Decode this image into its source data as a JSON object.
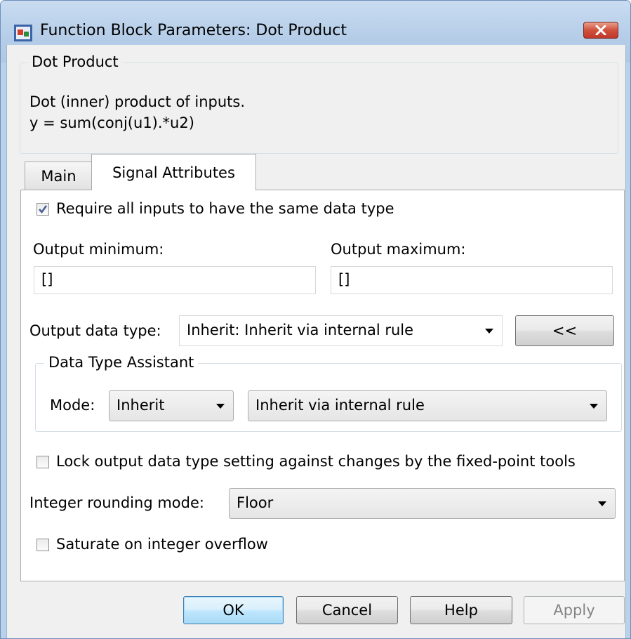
{
  "window": {
    "title": "Function Block Parameters: Dot Product"
  },
  "description": {
    "group_title": "Dot Product",
    "line1": "Dot (inner) product of inputs.",
    "line2": "y = sum(conj(u1).*u2)"
  },
  "tabs": [
    {
      "label": "Main",
      "selected": false
    },
    {
      "label": "Signal Attributes",
      "selected": true
    }
  ],
  "signal_attributes": {
    "require_same_type": {
      "label": "Require all inputs to have the same data type",
      "checked": true
    },
    "output_minimum": {
      "label": "Output minimum:",
      "value": "[]"
    },
    "output_maximum": {
      "label": "Output maximum:",
      "value": "[]"
    },
    "output_data_type": {
      "label": "Output data type:",
      "value": "Inherit: Inherit via internal rule",
      "toggle_button": "<<"
    },
    "data_type_assistant": {
      "title": "Data Type Assistant",
      "mode_label": "Mode:",
      "mode_value": "Inherit",
      "rule_value": "Inherit via internal rule"
    },
    "lock_output": {
      "label": "Lock output data type setting against changes by the fixed-point tools",
      "checked": false
    },
    "rounding": {
      "label": "Integer rounding mode:",
      "value": "Floor"
    },
    "saturate": {
      "label": "Saturate on integer overflow",
      "checked": false
    }
  },
  "buttons": {
    "ok": "OK",
    "cancel": "Cancel",
    "help": "Help",
    "apply": "Apply"
  }
}
